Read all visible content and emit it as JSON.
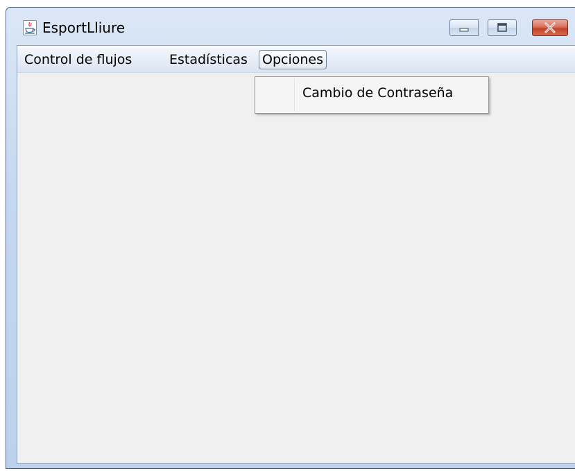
{
  "window": {
    "title": "EsportLliure",
    "icon": "java-cup-icon",
    "controls": [
      "minimize-icon",
      "maximize-icon",
      "close-icon"
    ]
  },
  "menubar": {
    "items": [
      {
        "label": "Control de flujos"
      },
      {
        "label": "Estadísticas"
      },
      {
        "label": "Opciones"
      }
    ]
  },
  "dropdown": {
    "items": [
      {
        "label": "Cambio de Contraseña"
      }
    ]
  }
}
